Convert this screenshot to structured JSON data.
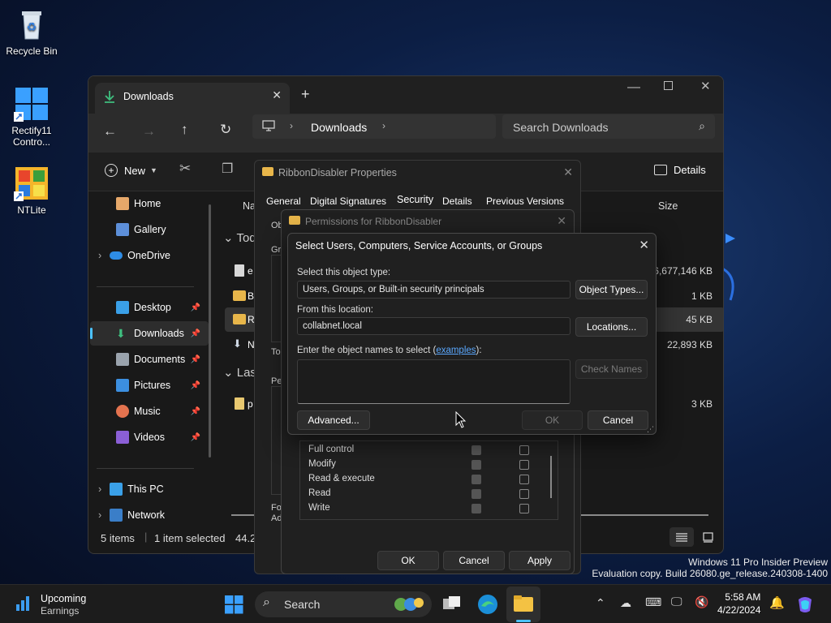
{
  "desktop": {
    "icons": [
      {
        "label": "Recycle Bin"
      },
      {
        "label": "Rectify11 Contro..."
      },
      {
        "label": "NTLite"
      }
    ],
    "watermark_line1": "Windows 11 Pro Insider Preview",
    "watermark_line2": "Evaluation copy. Build 26080.ge_release.240308-1400"
  },
  "explorer": {
    "tab_title": "Downloads",
    "breadcrumb": "Downloads",
    "search_placeholder": "Search Downloads",
    "new_label": "New",
    "details_label": "Details",
    "nav": {
      "home": "Home",
      "gallery": "Gallery",
      "onedrive": "OneDrive",
      "desktop": "Desktop",
      "downloads": "Downloads",
      "documents": "Documents",
      "pictures": "Pictures",
      "music": "Music",
      "videos": "Videos",
      "thispc": "This PC",
      "network": "Network"
    },
    "header_name": "Na",
    "header_size": "Size",
    "group_today": "Tod",
    "group_last": "Las",
    "rows": [
      {
        "name": "e",
        "size": "6,677,146 KB"
      },
      {
        "name": "B",
        "size": "1 KB"
      },
      {
        "name": "R",
        "size": "45 KB"
      },
      {
        "name": "N",
        "size": "22,893 KB"
      },
      {
        "name": "p",
        "size": "3 KB"
      }
    ],
    "status_items": "5 items",
    "status_selected": "1 item selected",
    "status_size": "44.2"
  },
  "props_dialog": {
    "title": "RibbonDisabler Properties",
    "tabs": [
      "General",
      "Digital Signatures",
      "Security",
      "Details",
      "Previous Versions"
    ],
    "side_labels": [
      "Ob",
      "Gr",
      "To",
      "Pe",
      "Fo",
      "Ad"
    ],
    "ok": "OK",
    "cancel": "Cancel",
    "apply": "Apply"
  },
  "perms_dialog": {
    "title": "Permissions for RibbonDisabler",
    "perm_rows": [
      "Full control",
      "Modify",
      "Read & execute",
      "Read",
      "Write"
    ]
  },
  "select_dialog": {
    "title": "Select Users, Computers, Service Accounts, or Groups",
    "object_type_label": "Select this object type:",
    "object_type_value": "Users, Groups, or Built-in security principals",
    "object_types_btn": "Object Types...",
    "location_label": "From this location:",
    "location_value": "collabnet.local",
    "locations_btn": "Locations...",
    "names_label_pre": "Enter the object names to select (",
    "names_link": "examples",
    "names_label_post": "):",
    "check_names_btn": "Check Names",
    "advanced_btn": "Advanced...",
    "ok_btn": "OK",
    "cancel_btn": "Cancel"
  },
  "taskbar": {
    "widget_line1": "Upcoming",
    "widget_line2": "Earnings",
    "search_label": "Search",
    "time": "5:58 AM",
    "date": "4/22/2024"
  },
  "colors": {
    "accent": "#4cc2ff",
    "link": "#5aa8ff"
  }
}
